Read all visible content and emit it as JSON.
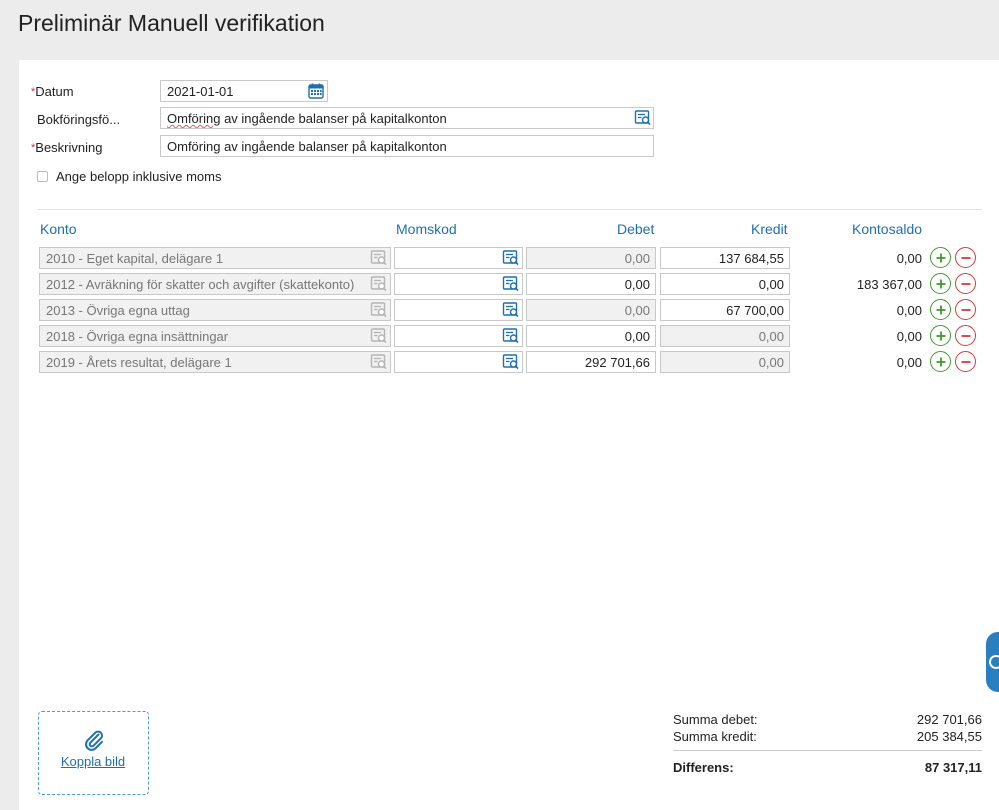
{
  "page": {
    "title": "Preliminär Manuell verifikation"
  },
  "form": {
    "datum_label": "Datum",
    "datum_value": "2021-01-01",
    "bokforing_label": "Bokföringsfö...",
    "bokforing_value_word1": "Omföring",
    "bokforing_value_rest": " av ingående balanser på kapitalkonton",
    "beskrivning_label": "Beskrivning",
    "beskrivning_value": "Omföring av ingående balanser på kapitalkonton",
    "required_mark": "*",
    "checkbox_label": "Ange belopp inklusive moms",
    "checkbox_checked": false
  },
  "table": {
    "headers": {
      "konto": "Konto",
      "momskod": "Momskod",
      "debet": "Debet",
      "kredit": "Kredit",
      "kontosaldo": "Kontosaldo"
    },
    "rows": [
      {
        "konto": "2010 - Eget kapital, delägare 1",
        "momskod": "",
        "debet": "0,00",
        "debet_disabled": true,
        "kredit": "137 684,55",
        "kredit_disabled": false,
        "saldo": "0,00"
      },
      {
        "konto": "2012 - Avräkning för skatter och avgifter (skattekonto)",
        "momskod": "",
        "debet": "0,00",
        "debet_disabled": false,
        "kredit": "0,00",
        "kredit_disabled": false,
        "saldo": "183 367,00"
      },
      {
        "konto": "2013 - Övriga egna uttag",
        "momskod": "",
        "debet": "0,00",
        "debet_disabled": true,
        "kredit": "67 700,00",
        "kredit_disabled": false,
        "saldo": "0,00"
      },
      {
        "konto": "2018 - Övriga egna insättningar",
        "momskod": "",
        "debet": "0,00",
        "debet_disabled": false,
        "kredit": "0,00",
        "kredit_disabled": true,
        "saldo": "0,00"
      },
      {
        "konto": "2019 - Årets resultat, delägare 1",
        "momskod": "",
        "debet": "292 701,66",
        "debet_disabled": false,
        "kredit": "0,00",
        "kredit_disabled": true,
        "saldo": "0,00"
      }
    ]
  },
  "attachment": {
    "label": "Koppla bild"
  },
  "summary": {
    "summa_debet_label": "Summa debet:",
    "summa_debet_value": "292 701,66",
    "summa_kredit_label": "Summa kredit:",
    "summa_kredit_value": "205 384,55",
    "differens_label": "Differens:",
    "differens_value": "87 317,11"
  },
  "colors": {
    "accent": "#1e6fb0",
    "plus": "#3f9b2e",
    "minus": "#d23c3c",
    "required": "#c0392b"
  }
}
